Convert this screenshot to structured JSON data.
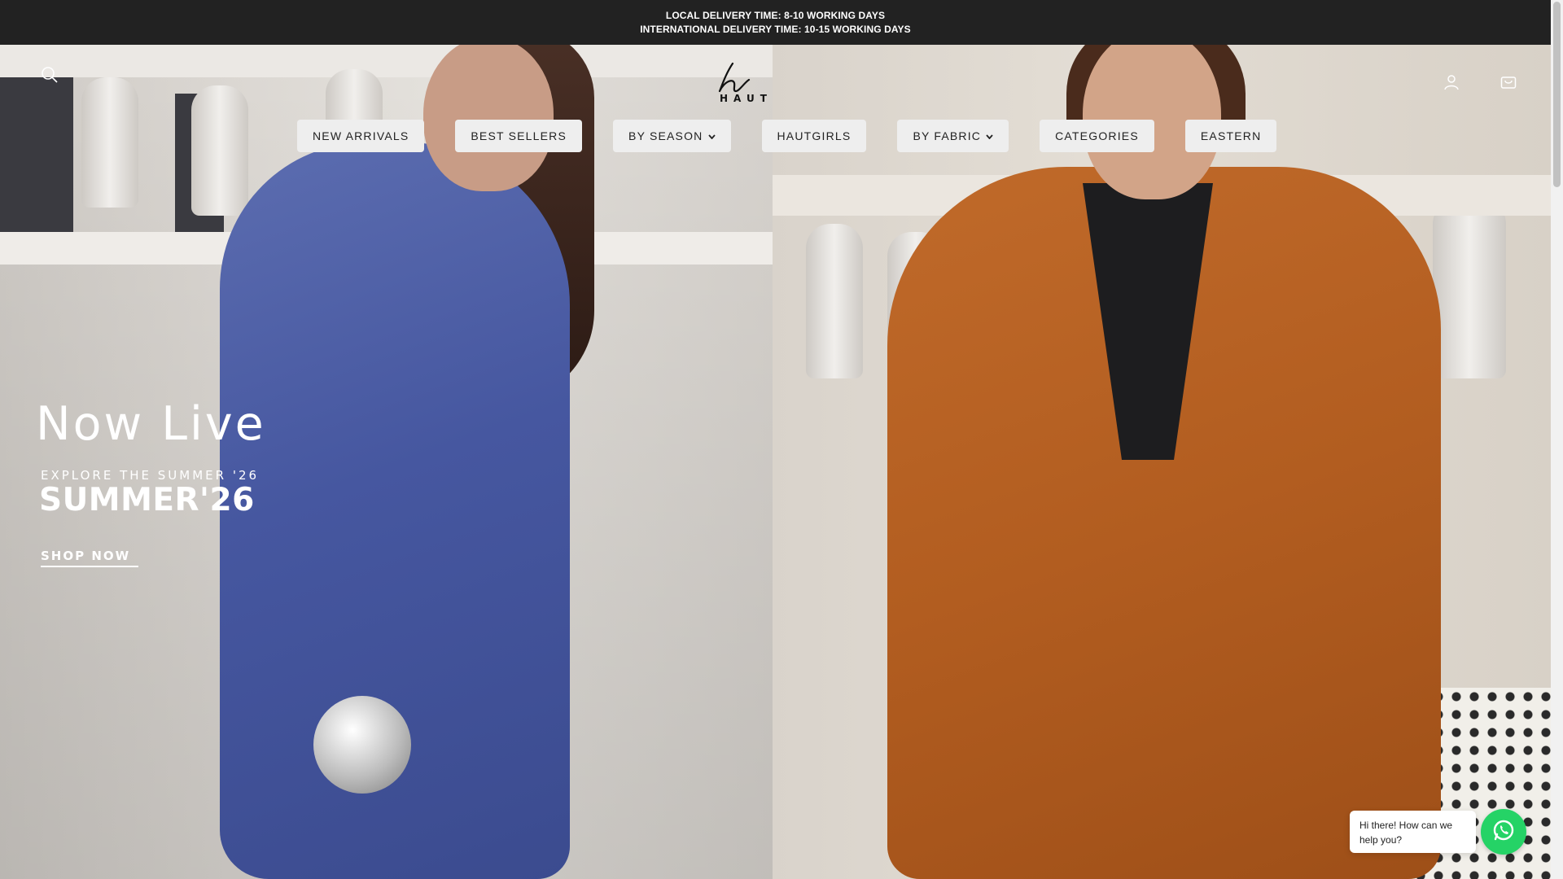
{
  "announcement": {
    "line1": "LOCAL DELIVERY TIME: 8-10 WORKING DAYS",
    "line2": "INTERNATIONAL DELIVERY TIME: 10-15 WORKING DAYS"
  },
  "header": {
    "logo_text": "HAUT",
    "icons": [
      "search-icon",
      "account-icon",
      "cart-icon"
    ]
  },
  "nav": {
    "items": [
      {
        "label": "NEW ARRIVALS",
        "has_dropdown": false
      },
      {
        "label": "BEST SELLERS",
        "has_dropdown": false
      },
      {
        "label": "BY SEASON",
        "has_dropdown": true
      },
      {
        "label": "HAUTGIRLS",
        "has_dropdown": false
      },
      {
        "label": "BY FABRIC",
        "has_dropdown": true
      },
      {
        "label": "CATEGORIES",
        "has_dropdown": false
      },
      {
        "label": "EASTERN",
        "has_dropdown": false
      }
    ],
    "caret": "⌄"
  },
  "hero": {
    "title": "Now Live",
    "subtitle": "EXPLORE THE SUMMER '26",
    "headline": "SUMMER'26",
    "cta": "SHOP NOW"
  },
  "whatsapp": {
    "message": "Hi there! How can we help you?",
    "color": "#25d366"
  },
  "colors": {
    "announcement_bg": "#222222",
    "nav_bg": "#eeeeee"
  }
}
